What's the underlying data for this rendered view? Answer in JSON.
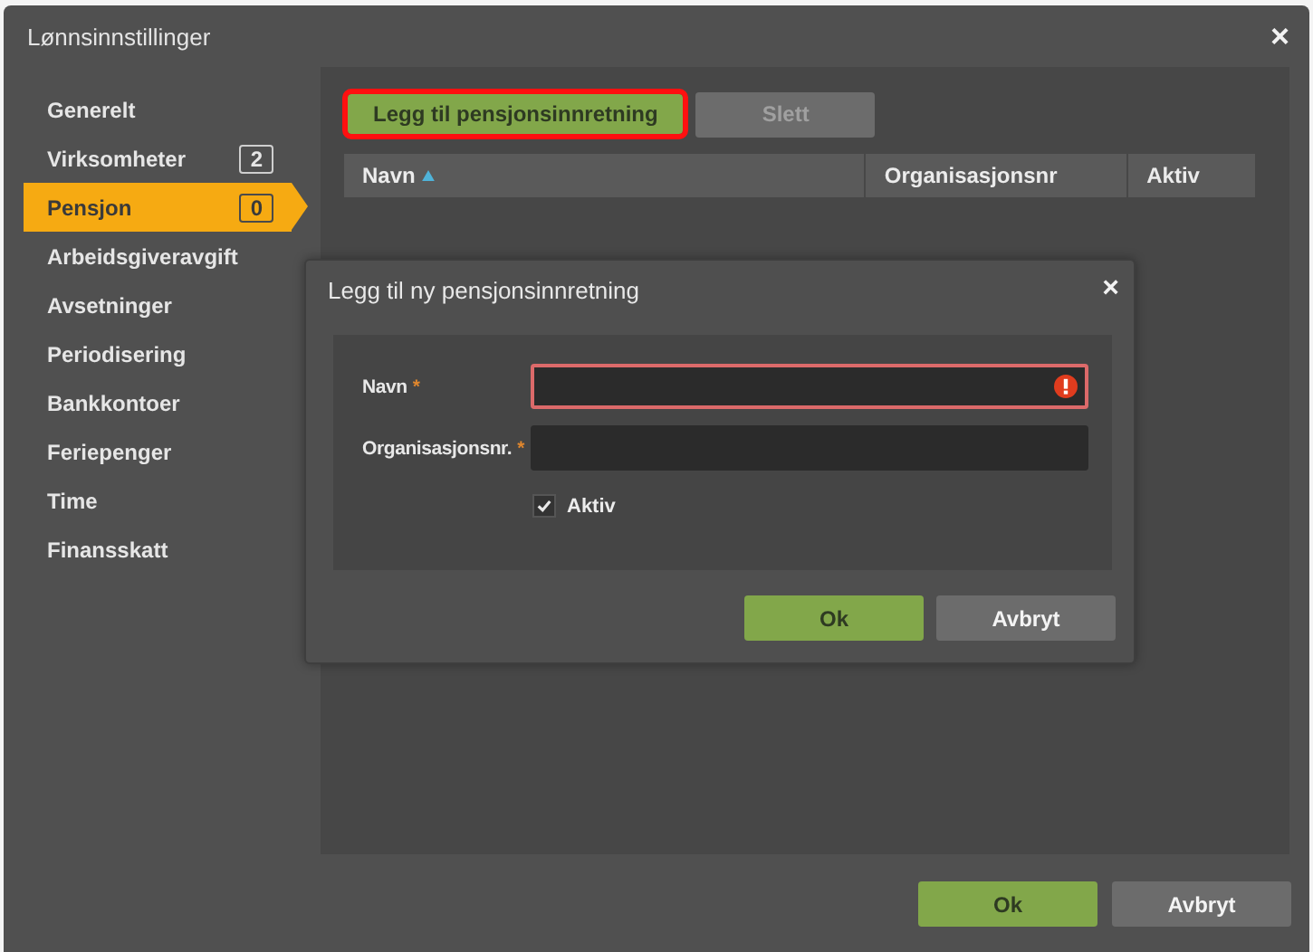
{
  "window": {
    "title": "Lønnsinnstillinger",
    "close": "×"
  },
  "sidebar": {
    "items": [
      {
        "label": "Generelt",
        "selected": false
      },
      {
        "label": "Virksomheter",
        "count": "2",
        "selected": false
      },
      {
        "label": "Pensjon",
        "count": "0",
        "selected": true
      },
      {
        "label": "Arbeidsgiveravgift",
        "selected": false
      },
      {
        "label": "Avsetninger",
        "selected": false
      },
      {
        "label": "Periodisering",
        "selected": false
      },
      {
        "label": "Bankkontoer",
        "selected": false
      },
      {
        "label": "Feriepenger",
        "selected": false
      },
      {
        "label": "Time",
        "selected": false
      },
      {
        "label": "Finansskatt",
        "selected": false
      }
    ]
  },
  "toolbar": [
    {
      "label": "Legg til pensjonsinnretning",
      "kind": "primary",
      "highlighted": true,
      "disabled": false
    },
    {
      "label": "Slett",
      "kind": "secondary",
      "highlighted": false,
      "disabled": true
    }
  ],
  "table": {
    "columns": [
      {
        "label": "Navn",
        "sorted": true
      },
      {
        "label": "Organisasjonsnr",
        "sorted": false
      },
      {
        "label": "Aktiv",
        "sorted": false
      }
    ]
  },
  "dialog": {
    "title": "Legg til ny pensjonsinnretning",
    "close": "×",
    "fields": [
      {
        "kind": "text",
        "label": "Navn",
        "required_mark": "*",
        "invalid": true
      },
      {
        "kind": "text",
        "label": "Organisasjonsnr.",
        "required_mark": "*",
        "invalid": false
      },
      {
        "kind": "checkbox",
        "label": "Aktiv",
        "checked": true
      }
    ],
    "buttons": [
      {
        "label": "Ok",
        "kind": "primary"
      },
      {
        "label": "Avbryt",
        "kind": "secondary"
      }
    ]
  },
  "footer": {
    "buttons": [
      {
        "label": "Ok",
        "kind": "primary"
      },
      {
        "label": "Avbryt",
        "kind": "secondary"
      }
    ]
  }
}
